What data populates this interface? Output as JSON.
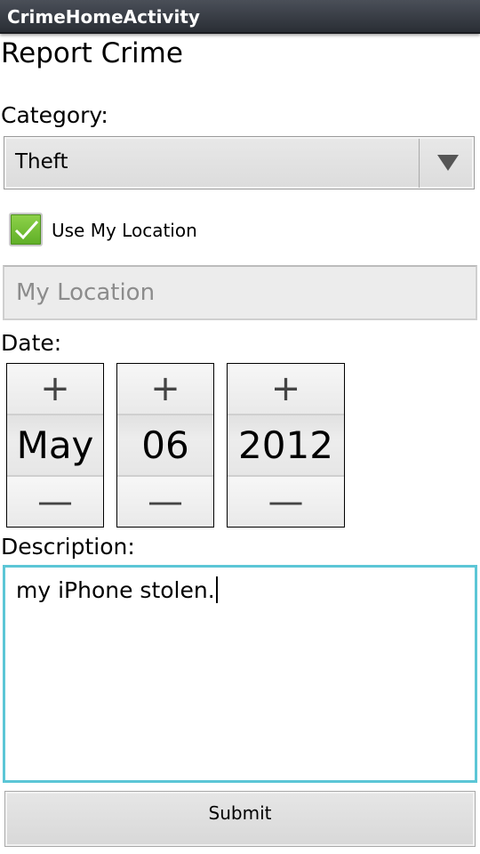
{
  "titlebar": {
    "title": "CrimeHomeActivity"
  },
  "form": {
    "heading": "Report Crime",
    "category_label": "Category:",
    "category_value": "Theft",
    "use_location_label": "Use My Location",
    "use_location_checked": true,
    "location_placeholder": "My Location",
    "date_label": "Date:",
    "date": {
      "month": "May",
      "day": "06",
      "year": "2012"
    },
    "stepper": {
      "plus": "+",
      "minus": "—"
    },
    "description_label": "Description:",
    "description_value": "my iPhone stolen.",
    "submit_label": "Submit"
  },
  "icons": {
    "spinner_arrow": "triangle-down-icon",
    "check": "checkmark-icon"
  },
  "colors": {
    "focus_border": "#5cc6d6",
    "checkbox_green": "#6cbb2e",
    "titlebar": "#343840"
  }
}
